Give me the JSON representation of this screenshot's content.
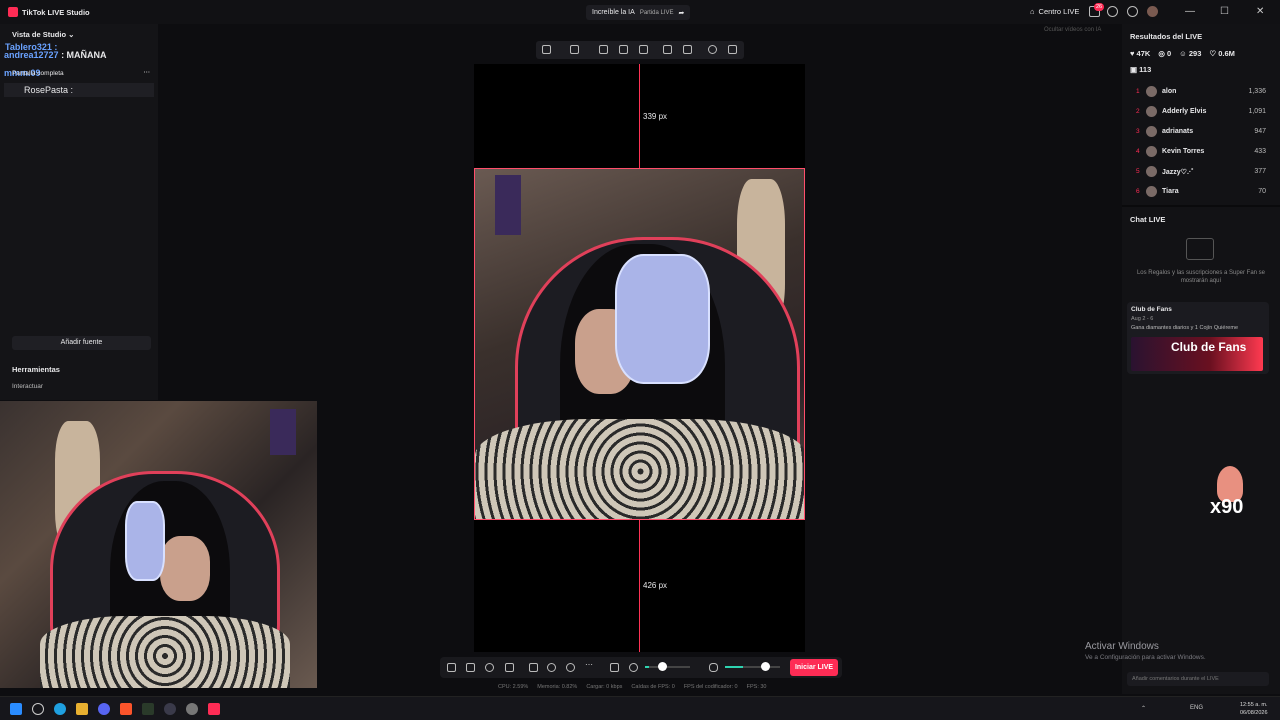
{
  "app": {
    "title": "TikTok LIVE Studio"
  },
  "header": {
    "stream_title": "Increíble la IA",
    "stream_sub": "Partida LIVE",
    "centro": "Centro LIVE",
    "notif_count": "26"
  },
  "left": {
    "vista": "Vista de Studio",
    "chat_line1": "Tablero321 :",
    "chat_line2": "andrea12727",
    "chat_line3": ": MAÑANA",
    "mode": "Pantalla completa",
    "mm_name": "mmm.09",
    "rose": "RosePasta :",
    "add_source": "Añadir fuente",
    "tools": "Herramientas",
    "interact": "Interactuar"
  },
  "canvas": {
    "top_px": "339 px",
    "bottom_px": "426 px"
  },
  "bottom": {
    "live_button": "Iniciar LIVE",
    "stats": [
      "CPU: 2.59%",
      "Memoria: 0.82%",
      "Cargar: 0 kbps",
      "Caídas de FPS: 0",
      "FPS del codificador: 0",
      "FPS: 30"
    ]
  },
  "right": {
    "results_title": "Resultados del LIVE",
    "stats": {
      "viewers": "47K",
      "zero": "0",
      "people": "293",
      "likes": "0.6M",
      "gifts": "113"
    },
    "ranking": [
      {
        "rank": "1",
        "name": "alon",
        "score": "1,336"
      },
      {
        "rank": "2",
        "name": "Adderly Elvis",
        "score": "1,091"
      },
      {
        "rank": "3",
        "name": "adrianats",
        "score": "947"
      },
      {
        "rank": "4",
        "name": "Kevin Torres",
        "score": "433"
      },
      {
        "rank": "5",
        "name": "Jazzy♡.·˚",
        "score": "377"
      },
      {
        "rank": "6",
        "name": "Tiara",
        "score": "70"
      }
    ],
    "chat_title": "Chat LIVE",
    "gifts_text": "Los Regalos y las suscripciones a Super Fan se mostrarán aquí",
    "club_title": "Club de Fans",
    "club_date": "Aug 2 - 6",
    "club_gain": "Gana diamantes diarios y 1 Cojín Quiéreme",
    "club_banner": "Club de Fans",
    "gift_multiplier": "x90",
    "comment_placeholder": "Añadir comentarios durante el LIVE",
    "recent": "Ocultar vídeos con IA"
  },
  "windows": {
    "activate": "Activar Windows",
    "activate_sub": "Ve a Configuración para activar Windows."
  },
  "taskbar": {
    "lang": "ENG",
    "time": "12:55 a. m.",
    "date": "06/08/2026"
  },
  "colors": {
    "accent": "#fe2c55",
    "guide": "#ff3355",
    "teal": "#2ed3b0"
  }
}
